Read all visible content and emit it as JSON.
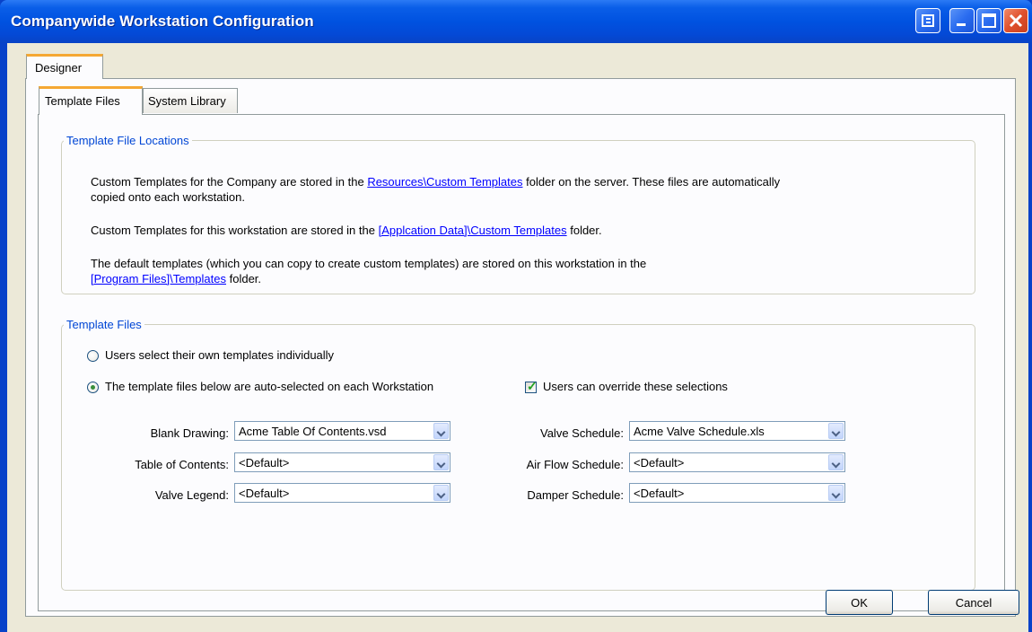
{
  "window": {
    "title": "Companywide Workstation Configuration"
  },
  "tabs": {
    "outer": "Designer",
    "template_files": "Template Files",
    "system_library": "System Library"
  },
  "locations": {
    "legend": "Template File Locations",
    "p1_before": "Custom Templates for the Company are stored in the ",
    "p1_link": "Resources\\Custom Templates",
    "p1_after": " folder on the server.  These files are automatically",
    "p1_line2": "copied onto each workstation.",
    "p2_before": "Custom Templates for this workstation are stored in the ",
    "p2_link": "[Applcation Data]\\Custom Templates",
    "p2_after": " folder.",
    "p3_line1": "The default templates (which you can copy to create custom templates) are stored on this workstation in the",
    "p3_link": "[Program Files]\\Templates",
    "p3_after": " folder."
  },
  "files": {
    "legend": "Template Files",
    "radio_individual": "Users select their own templates individually",
    "radio_auto": "The template files below are auto-selected on each Workstation",
    "checkbox_override": "Users can override these selections",
    "blank_drawing_label": "Blank Drawing:",
    "blank_drawing_value": "Acme Table Of Contents.vsd",
    "toc_label": "Table of Contents:",
    "toc_value": "<Default>",
    "valve_legend_label": "Valve Legend:",
    "valve_legend_value": "<Default>",
    "valve_schedule_label": "Valve Schedule:",
    "valve_schedule_value": "Acme Valve Schedule.xls",
    "air_flow_label": "Air Flow Schedule:",
    "air_flow_value": "<Default>",
    "damper_label": "Damper Schedule:",
    "damper_value": "<Default>"
  },
  "buttons": {
    "ok": "OK",
    "cancel": "Cancel"
  }
}
